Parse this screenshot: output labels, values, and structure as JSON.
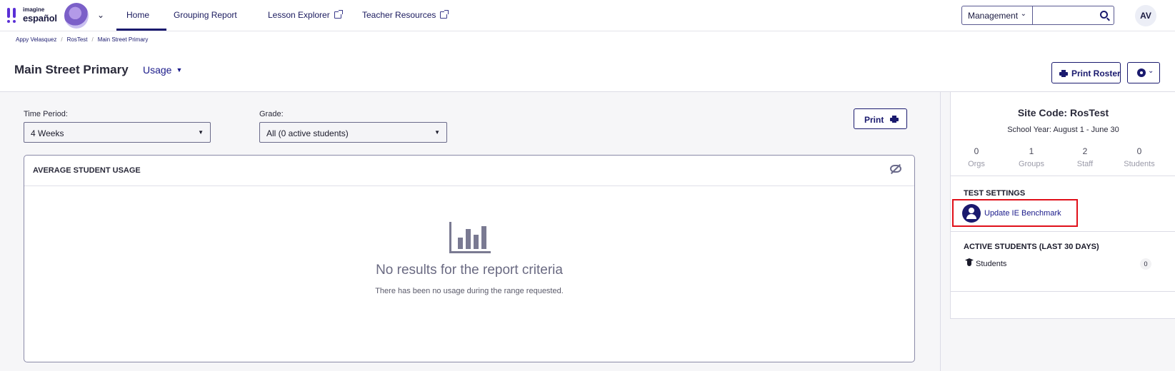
{
  "brand": {
    "line1": "imagine",
    "line2": "español"
  },
  "nav": {
    "items": [
      {
        "label": "Home"
      },
      {
        "label": "Grouping Report"
      },
      {
        "label": "Lesson Explorer"
      },
      {
        "label": "Teacher Resources"
      }
    ],
    "management_label": "Management",
    "search_placeholder": "",
    "avatar_initials": "AV"
  },
  "breadcrumb": [
    "Appy Velasquez",
    "RosTest",
    "Main Street Primary"
  ],
  "header": {
    "title": "Main Street Primary",
    "view_label": "Usage",
    "print_roster_label": "Print Roster"
  },
  "filters": {
    "time_period_label": "Time Period:",
    "time_period_value": "4 Weeks",
    "grade_label": "Grade:",
    "grade_value": "All (0 active students)",
    "print_label": "Print"
  },
  "usage_card": {
    "title": "AVERAGE STUDENT USAGE",
    "empty_title": "No results for the report criteria",
    "empty_subtitle": "There has been no usage during the range requested."
  },
  "site": {
    "code_label": "Site Code: RosTest",
    "school_year": "School Year: August 1 - June 30",
    "stats": [
      {
        "value": "0",
        "label": "Orgs"
      },
      {
        "value": "1",
        "label": "Groups"
      },
      {
        "value": "2",
        "label": "Staff"
      },
      {
        "value": "0",
        "label": "Students"
      }
    ],
    "test_settings_title": "TEST SETTINGS",
    "update_benchmark_label": "Update IE Benchmark",
    "active_students_title": "ACTIVE STUDENTS  (LAST 30 DAYS)",
    "students_label": "Students",
    "students_count": "0"
  },
  "colors": {
    "brand_navy": "#1a1a6e",
    "highlight_red": "#e0101a",
    "brand_purple": "#5a2fd6"
  }
}
